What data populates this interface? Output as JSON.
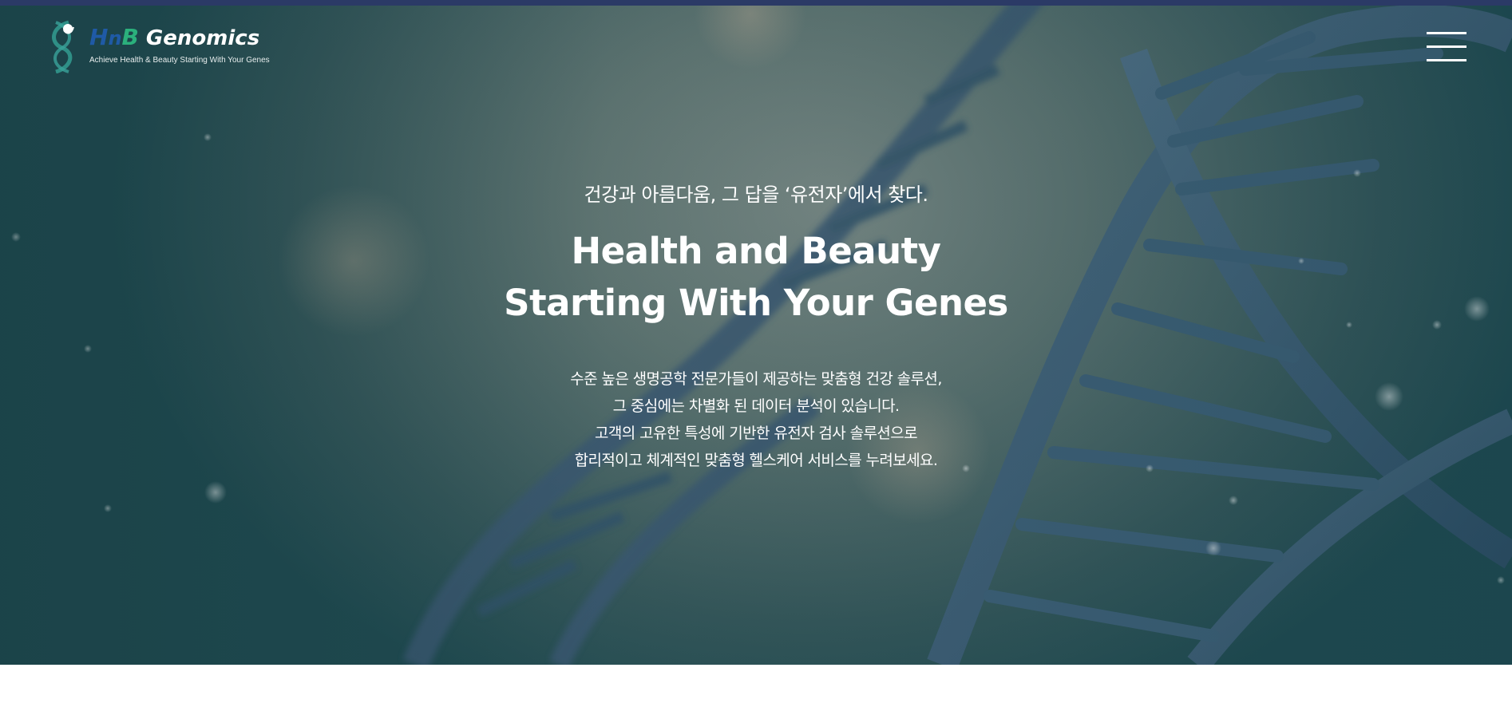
{
  "brand": {
    "name_h": "H",
    "name_n": "n",
    "name_b": "B",
    "name_rest": " Genomics",
    "tagline": "Achieve Health & Beauty Starting With Your Genes",
    "colors": {
      "primary_blue": "#1f5aa6",
      "accent_green": "#2bb07c",
      "top_bar": "#2b3a66"
    }
  },
  "header": {
    "menu_icon": "hamburger-menu-icon"
  },
  "hero": {
    "subheading": "건강과 아름다움, 그 답을 ‘유전자’에서 찾다.",
    "headline": [
      "Health and Beauty",
      "Starting With Your Genes"
    ],
    "description": [
      "수준 높은 생명공학 전문가들이 제공하는 맞춤형 건강 솔루션,",
      "그 중심에는 차별화 된 데이터 분석이 있습니다.",
      "고객의 고유한 특성에 기반한 유전자 검사 솔루션으로",
      "합리적이고 체계적인 맞춤형 헬스케어 서비스를 누려보세요."
    ],
    "background_image": "dna-double-helix"
  }
}
